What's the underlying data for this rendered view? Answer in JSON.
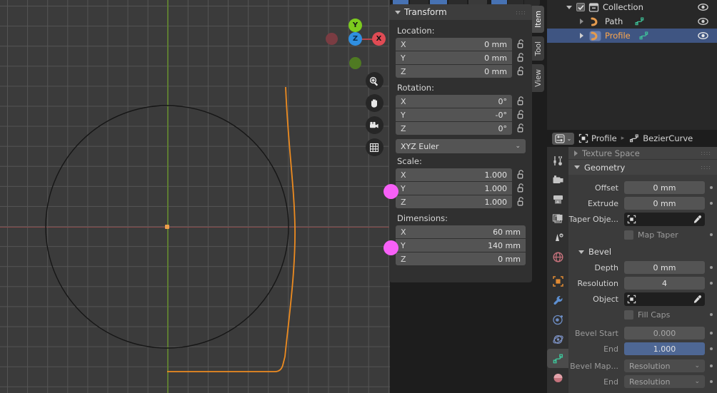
{
  "app": {
    "theme_bg": "#1d1d1d",
    "accent_orange": "#ed9e4b",
    "accent_blue": "#4772b3",
    "select_blue": "#3f5582"
  },
  "viewport": {
    "name": "3d-viewport",
    "gizmo": {
      "axes": [
        {
          "label": "Y",
          "color": "#7ccb1e",
          "pos": "top"
        },
        {
          "label": "Z",
          "color": "#2f8fe0",
          "pos": "center"
        },
        {
          "label": "X",
          "color": "#e04b54",
          "pos": "right"
        },
        {
          "label": "",
          "color": "#7a3c42",
          "pos": "left"
        },
        {
          "label": "",
          "color": "#4f7a22",
          "pos": "bottom"
        }
      ]
    },
    "tools": [
      {
        "name": "zoom-icon",
        "glyph": "zoom"
      },
      {
        "name": "pan-hand-icon",
        "glyph": "hand"
      },
      {
        "name": "camera-view-icon",
        "glyph": "camera"
      },
      {
        "name": "toggle-orthographic-icon",
        "glyph": "grid"
      }
    ],
    "objects": {
      "path_circle_color": "#1a1a1a",
      "profile_curve_color": "#ed8b20"
    }
  },
  "npanel": {
    "title": "Transform",
    "tabs": [
      {
        "label": "Item",
        "active": true
      },
      {
        "label": "Tool",
        "active": false
      },
      {
        "label": "View",
        "active": false
      }
    ],
    "location": {
      "label": "Location:",
      "rows": [
        {
          "axis": "X",
          "value": "0 mm"
        },
        {
          "axis": "Y",
          "value": "0 mm"
        },
        {
          "axis": "Z",
          "value": "0 mm"
        }
      ]
    },
    "rotation": {
      "label": "Rotation:",
      "rows": [
        {
          "axis": "X",
          "value": "0°"
        },
        {
          "axis": "Y",
          "value": "-0°"
        },
        {
          "axis": "Z",
          "value": "0°"
        }
      ],
      "mode": "XYZ Euler"
    },
    "scale": {
      "label": "Scale:",
      "rows": [
        {
          "axis": "X",
          "value": "1.000"
        },
        {
          "axis": "Y",
          "value": "1.000"
        },
        {
          "axis": "Z",
          "value": "1.000"
        }
      ]
    },
    "dimensions": {
      "label": "Dimensions:",
      "rows": [
        {
          "axis": "X",
          "value": "60 mm"
        },
        {
          "axis": "Y",
          "value": "140 mm"
        },
        {
          "axis": "Z",
          "value": "0 mm"
        }
      ]
    }
  },
  "outliner": {
    "rows": [
      {
        "name": "Collection",
        "type": "collection",
        "selected": false,
        "indent": 0,
        "checkbox": true,
        "expanded": true
      },
      {
        "name": "Path",
        "type": "curve",
        "selected": false,
        "indent": 1,
        "checkbox": false,
        "expanded": false
      },
      {
        "name": "Profile",
        "type": "curve",
        "selected": true,
        "indent": 1,
        "checkbox": false,
        "expanded": false
      }
    ]
  },
  "properties": {
    "breadcrumb": [
      {
        "label": "Profile",
        "icon": "object-icon"
      },
      {
        "label": "BezierCurve",
        "icon": "curve-data-icon"
      }
    ],
    "tabs": [
      {
        "name": "tool-tab",
        "active": false
      },
      {
        "name": "render-tab",
        "active": false
      },
      {
        "name": "output-tab",
        "active": false
      },
      {
        "name": "view-layer-tab",
        "active": false
      },
      {
        "name": "scene-tab",
        "active": false
      },
      {
        "name": "world-tab",
        "active": false
      },
      {
        "name": "object-tab",
        "active": false
      },
      {
        "name": "modifiers-tab",
        "active": false
      },
      {
        "name": "particles-tab",
        "active": false
      },
      {
        "name": "physics-tab",
        "active": false
      },
      {
        "name": "object-data-tab",
        "active": true
      },
      {
        "name": "material-tab",
        "active": false
      }
    ],
    "panels": [
      {
        "title": "Texture Space",
        "collapsed": true
      },
      {
        "title": "Geometry",
        "collapsed": false
      }
    ],
    "geometry": {
      "rows": [
        {
          "label": "Offset",
          "value": "0 mm",
          "kind": "number"
        },
        {
          "label": "Extrude",
          "value": "0 mm",
          "kind": "number"
        },
        {
          "label": "Taper Obje...",
          "value": "",
          "kind": "object"
        }
      ],
      "map_taper": {
        "label": "Map Taper",
        "checked": false
      }
    },
    "bevel": {
      "title": "Bevel",
      "rows": [
        {
          "label": "Depth",
          "value": "0 mm",
          "kind": "number"
        },
        {
          "label": "Resolution",
          "value": "4",
          "kind": "number"
        },
        {
          "label": "Object",
          "value": "",
          "kind": "object"
        }
      ],
      "fill_caps": {
        "label": "Fill Caps",
        "checked": false
      },
      "start_end": [
        {
          "label": "Bevel Start",
          "value": "0.000",
          "kind": "number",
          "dim": true
        },
        {
          "label": "End",
          "value": "1.000",
          "kind": "number-active",
          "dim": true
        }
      ],
      "mapping": [
        {
          "label": "Bevel Map...",
          "value": "Resolution",
          "kind": "dropdown"
        },
        {
          "label": "End",
          "value": "Resolution",
          "kind": "dropdown"
        }
      ]
    }
  }
}
